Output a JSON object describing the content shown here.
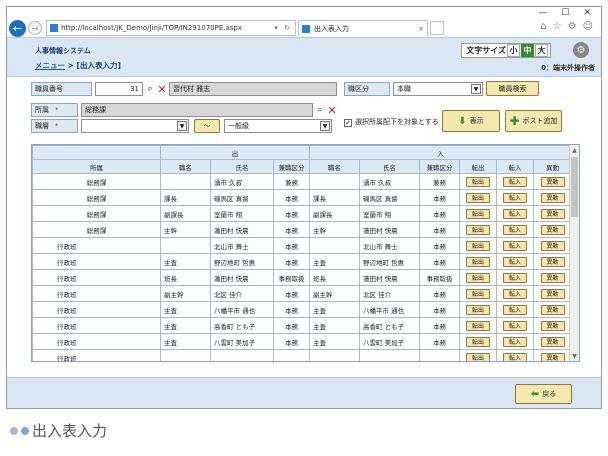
{
  "browser": {
    "url": "http://localhost/JK_Demo/Jinji/TOP/IN291070PE.aspx",
    "tab_title": "出入表入力",
    "minimize": "—",
    "maximize": "☐",
    "close": "✕",
    "back_glyph": "←",
    "forward_glyph": "→",
    "addr_icons": "▾ ↻",
    "tab_close": "×",
    "tool_icons": [
      "⌂",
      "☆",
      "⚙",
      "☺"
    ]
  },
  "header": {
    "system_title": "人事情報システム",
    "breadcrumb_link": "メニュー",
    "breadcrumb_sep": ">",
    "breadcrumb_current": "[出入表入力]",
    "font_size_label": "文字サイズ",
    "font_size_options": [
      "小",
      "中",
      "大"
    ],
    "active_font_size": "中",
    "user_context": "0：端末外操作者"
  },
  "form": {
    "staff_no_label": "職員番号",
    "staff_no_value": "31",
    "staff_name_value": "習代村 雅志",
    "job_type_label": "職区分",
    "job_type_value": "本職",
    "staff_search_btn": "職員検索",
    "dept_label": "所属",
    "dept_value": "総務課",
    "title_label": "職層",
    "title_value": "",
    "tilde": "～",
    "rank_value": "一般級",
    "required_mark": "*",
    "include_sub_label": "選択所属配下を対象とする",
    "include_sub_checked": "✓",
    "display_btn": "表示",
    "post_add_btn": "ポスト追加",
    "back_btn": "戻る"
  },
  "table": {
    "group_out": "出",
    "group_in": "入",
    "headers": [
      "所属",
      "職名",
      "氏名",
      "兼職区分",
      "職名",
      "氏名",
      "兼職区分",
      "転出",
      "転入",
      "異動"
    ],
    "btn_out": "転出",
    "btn_in": "転入",
    "btn_move": "異動",
    "rows": [
      {
        "dept": "総務課",
        "indent": false,
        "out_title": "",
        "out_name": "湧市 久叔",
        "out_type": "兼務",
        "in_title": "",
        "in_name": "湧市 久叔",
        "in_type": "兼務"
      },
      {
        "dept": "総務課",
        "indent": false,
        "out_title": "課長",
        "out_name": "磯馬区 真督",
        "out_type": "本務",
        "in_title": "課長",
        "in_name": "磯馬区 真督",
        "in_type": "本務"
      },
      {
        "dept": "総務課",
        "indent": false,
        "out_title": "副課長",
        "out_name": "室蘭市 翔",
        "out_type": "本務",
        "in_title": "副課長",
        "in_name": "室蘭市 翔",
        "in_type": "本務"
      },
      {
        "dept": "総務課",
        "indent": false,
        "out_title": "主幹",
        "out_name": "蓮田村 快晨",
        "out_type": "本務",
        "in_title": "主幹",
        "in_name": "蓮田村 快晨",
        "in_type": "本務"
      },
      {
        "dept": "行政班",
        "indent": true,
        "out_title": "",
        "out_name": "北山市 舞士",
        "out_type": "本務",
        "in_title": "",
        "in_name": "北山市 舞士",
        "in_type": "本務"
      },
      {
        "dept": "行政班",
        "indent": true,
        "out_title": "主査",
        "out_name": "野辺地町 哲惠",
        "out_type": "本務",
        "in_title": "主査",
        "in_name": "野辺地町 哲惠",
        "in_type": "本務"
      },
      {
        "dept": "行政班",
        "indent": true,
        "out_title": "班長",
        "out_name": "蓮田村 快晨",
        "out_type": "事務取扱",
        "in_title": "班長",
        "in_name": "蓮田村 快晨",
        "in_type": "事務取扱"
      },
      {
        "dept": "行政班",
        "indent": true,
        "out_title": "副主幹",
        "out_name": "北区 佳介",
        "out_type": "本務",
        "in_title": "副主幹",
        "in_name": "北区 佳介",
        "in_type": "本務"
      },
      {
        "dept": "行政班",
        "indent": true,
        "out_title": "主査",
        "out_name": "八幡平市 通也",
        "out_type": "本務",
        "in_title": "主査",
        "in_name": "八幡平市 通也",
        "in_type": "本務"
      },
      {
        "dept": "行政班",
        "indent": true,
        "out_title": "主査",
        "out_name": "高香町 とも子",
        "out_type": "本務",
        "in_title": "主査",
        "in_name": "高香町 とも子",
        "in_type": "本務"
      },
      {
        "dept": "行政班",
        "indent": true,
        "out_title": "主査",
        "out_name": "八雲町 美加子",
        "out_type": "本務",
        "in_title": "主査",
        "in_name": "八雲町 美加子",
        "in_type": "本務"
      },
      {
        "dept": "行政班",
        "indent": true,
        "out_title": "",
        "out_name": "",
        "out_type": "",
        "in_title": "",
        "in_name": "",
        "in_type": ""
      }
    ]
  },
  "caption": "出入表入力",
  "colors": {
    "accent": "#1a6fc4",
    "button": "#f6e7ae",
    "header_bg": "#d9e7f5",
    "green": "#2f8f2f",
    "dot_blue": "#7aa6e0",
    "dot_gray": "#a9b9cc"
  }
}
